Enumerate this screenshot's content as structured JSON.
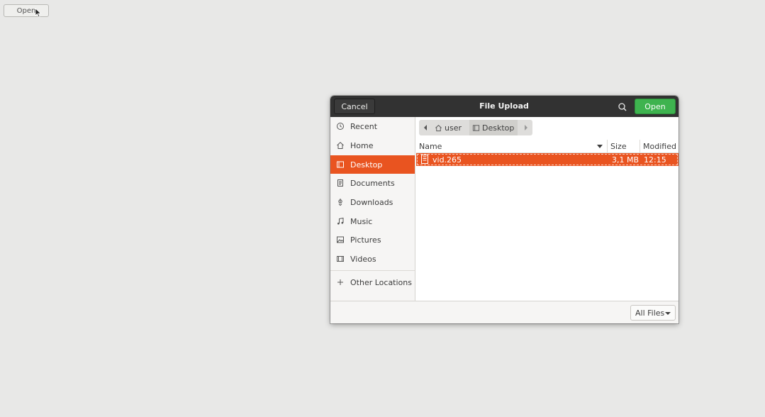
{
  "page": {
    "open_label": "Open"
  },
  "dialog": {
    "title": "File Upload",
    "cancel_label": "Cancel",
    "open_label": "Open",
    "sidebar": {
      "items": [
        {
          "label": "Recent",
          "icon": "clock-icon"
        },
        {
          "label": "Home",
          "icon": "home-icon"
        },
        {
          "label": "Desktop",
          "icon": "desktop-icon",
          "active": true
        },
        {
          "label": "Documents",
          "icon": "document-icon"
        },
        {
          "label": "Downloads",
          "icon": "download-icon"
        },
        {
          "label": "Music",
          "icon": "music-icon"
        },
        {
          "label": "Pictures",
          "icon": "picture-icon"
        },
        {
          "label": "Videos",
          "icon": "video-icon"
        },
        {
          "label": "Other Locations",
          "icon": "plus-icon"
        }
      ]
    },
    "path": {
      "crumbs": [
        "user",
        "Desktop"
      ]
    },
    "columns": {
      "name": "Name",
      "size": "Size",
      "modified": "Modified"
    },
    "files": [
      {
        "name": "vid.265",
        "size": "3,1 MB",
        "modified": "12:15",
        "selected": true
      }
    ],
    "filter": {
      "selected": "All Files"
    },
    "colors": {
      "accent": "#e95420",
      "open_button": "#3eb34f",
      "header": "#323232"
    }
  }
}
